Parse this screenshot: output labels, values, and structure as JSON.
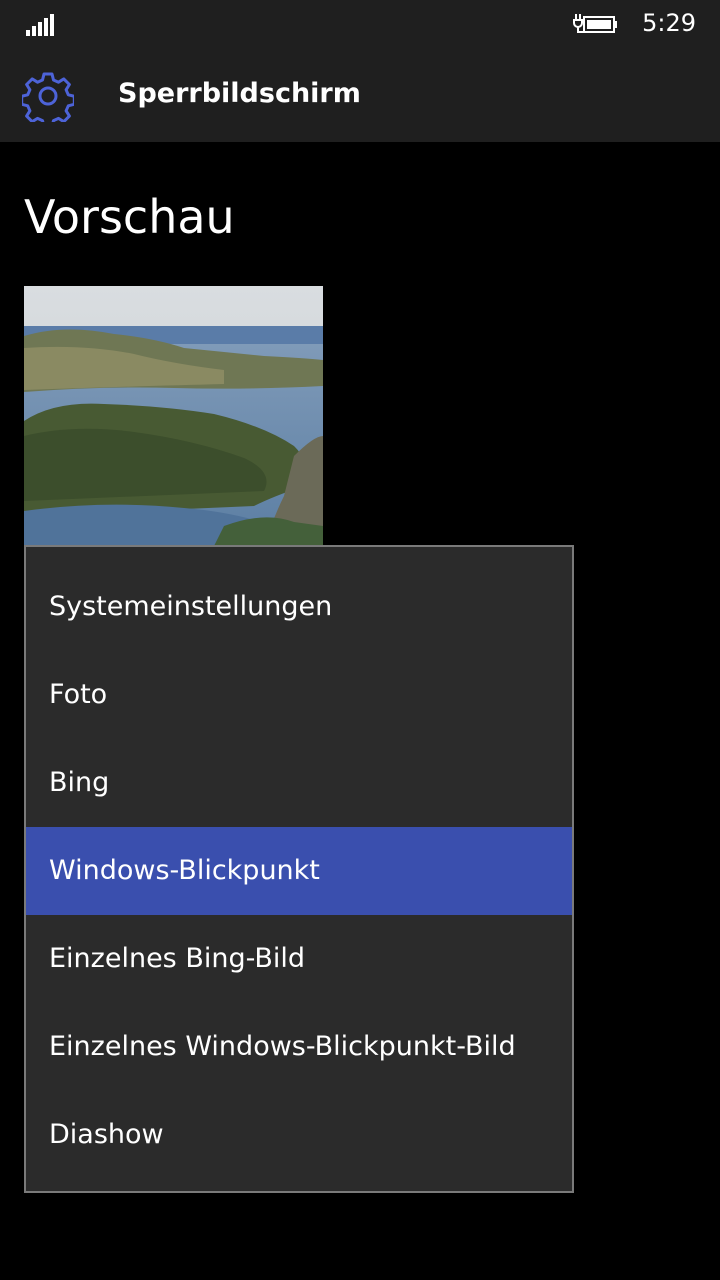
{
  "status_bar": {
    "time": "5:29",
    "signal_icon": "signal-strength-icon",
    "battery_icon": "battery-charging-icon"
  },
  "header": {
    "title": "Sperrbildschirm",
    "icon": "gear-icon",
    "accent_color": "#4d63d8"
  },
  "preview": {
    "heading": "Vorschau"
  },
  "dropdown": {
    "selected_index": 3,
    "selected_color": "#3a4fae",
    "items": [
      {
        "label": "Systemeinstellungen"
      },
      {
        "label": "Foto"
      },
      {
        "label": "Bing"
      },
      {
        "label": "Windows-Blickpunkt"
      },
      {
        "label": "Einzelnes Bing-Bild"
      },
      {
        "label": "Einzelnes Windows-Blickpunkt-Bild"
      },
      {
        "label": "Diashow"
      }
    ]
  }
}
